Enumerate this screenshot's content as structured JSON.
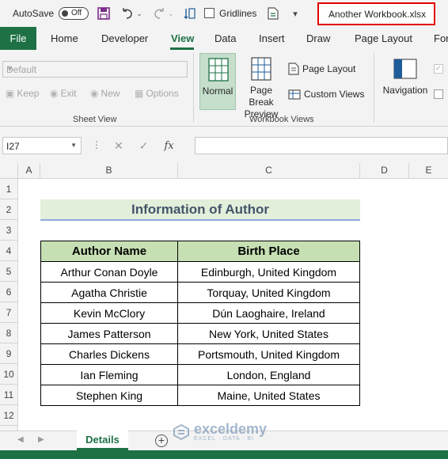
{
  "titlebar": {
    "autosave_label": "AutoSave",
    "autosave_state": "Off",
    "gridlines_label": "Gridlines",
    "workbook_name": "Another Workbook.xlsx"
  },
  "tabs": {
    "file": "File",
    "items": [
      "Home",
      "Developer",
      "View",
      "Data",
      "Insert",
      "Draw",
      "Page Layout",
      "For"
    ],
    "active": "View"
  },
  "ribbon": {
    "sheet_view": {
      "dropdown_value": "Default",
      "keep": "Keep",
      "exit": "Exit",
      "new": "New",
      "options": "Options",
      "group_label": "Sheet View"
    },
    "workbook_views": {
      "normal": "Normal",
      "page_break_line1": "Page Break",
      "page_break_line2": "Preview",
      "page_layout": "Page Layout",
      "custom_views": "Custom Views",
      "group_label": "Workbook Views"
    },
    "navigation": "Navigation"
  },
  "formula_bar": {
    "name_box": "I27",
    "fx": "fx",
    "formula": ""
  },
  "grid": {
    "columns": [
      "A",
      "B",
      "C",
      "D",
      "E"
    ],
    "rows": [
      "1",
      "2",
      "3",
      "4",
      "5",
      "6",
      "7",
      "8",
      "9",
      "10",
      "11",
      "12"
    ],
    "title": "Information of Author",
    "table": {
      "headers": [
        "Author Name",
        "Birth Place"
      ],
      "rows": [
        [
          "Arthur Conan Doyle",
          "Edinburgh, United Kingdom"
        ],
        [
          "Agatha Christie",
          "Torquay, United Kingdom"
        ],
        [
          "Kevin McClory",
          "Dún Laoghaire, Ireland"
        ],
        [
          "James Patterson",
          "New York, United States"
        ],
        [
          "Charles Dickens",
          "Portsmouth, United Kingdom"
        ],
        [
          "Ian Fleming",
          "London, England"
        ],
        [
          "Stephen King",
          "Maine, United States"
        ]
      ]
    }
  },
  "sheets": {
    "active": "Details",
    "add_label": "+"
  },
  "watermark": {
    "brand": "exceldemy",
    "tagline": "EXCEL · DATA · BI"
  },
  "colors": {
    "excel_green": "#1e7145",
    "header_fill": "#c6e0b4",
    "title_fill": "#e2efda",
    "highlight_border": "#e30000"
  }
}
